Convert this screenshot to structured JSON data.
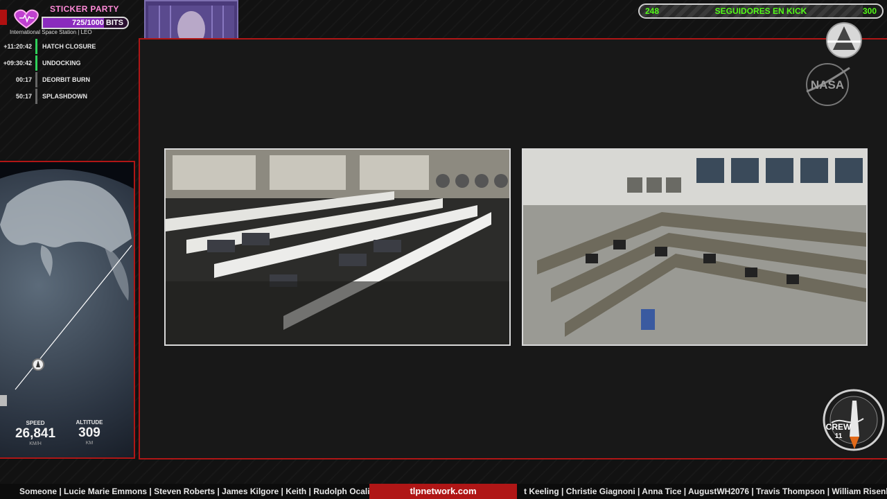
{
  "sticker_party": {
    "title": "STICKER PARTY",
    "bits": "725/1000 BITS",
    "progress_fraction": 0.725,
    "subtitle": "International Space Station | LEO",
    "accent": "#8a2bbd"
  },
  "timeline": [
    {
      "time": "+11:20:42",
      "event": "HATCH CLOSURE",
      "color": "#2fd05a"
    },
    {
      "time": "+09:30:42",
      "event": "UNDOCKING",
      "color": "#2fd05a"
    },
    {
      "time": "00:17",
      "event": "DEORBIT BURN",
      "color": "#666666"
    },
    {
      "time": "50:17",
      "event": "SPLASHDOWN",
      "color": "#666666"
    }
  ],
  "stats": {
    "speed": {
      "label": "SPEED",
      "value": "26,841",
      "unit": "KM/H"
    },
    "altitude": {
      "label": "ALTITUDE",
      "value": "309",
      "unit": "KM"
    }
  },
  "kick": {
    "start": "248",
    "label": "SEGUIDORES EN KICK",
    "end": "300",
    "accent": "#53fc18"
  },
  "logos": {
    "nasa": "NASA",
    "crew": "CREW",
    "crew_number": "11"
  },
  "feeds": [
    {
      "name": "mission-control-feed-left"
    },
    {
      "name": "mission-control-feed-right"
    }
  ],
  "ticker": {
    "left": "Someone | Lucie Marie Emmons | Steven Roberts | James Kilgore | Keith | Rudolph Ocalia",
    "site": "tlpnetwork.com",
    "right": "t Keeling | Christie Giagnoni | Anna Tice | AugustWH2076 | Travis Thompson | William Risenh"
  },
  "colors": {
    "frame_red": "#b01616",
    "background": "#121212"
  }
}
